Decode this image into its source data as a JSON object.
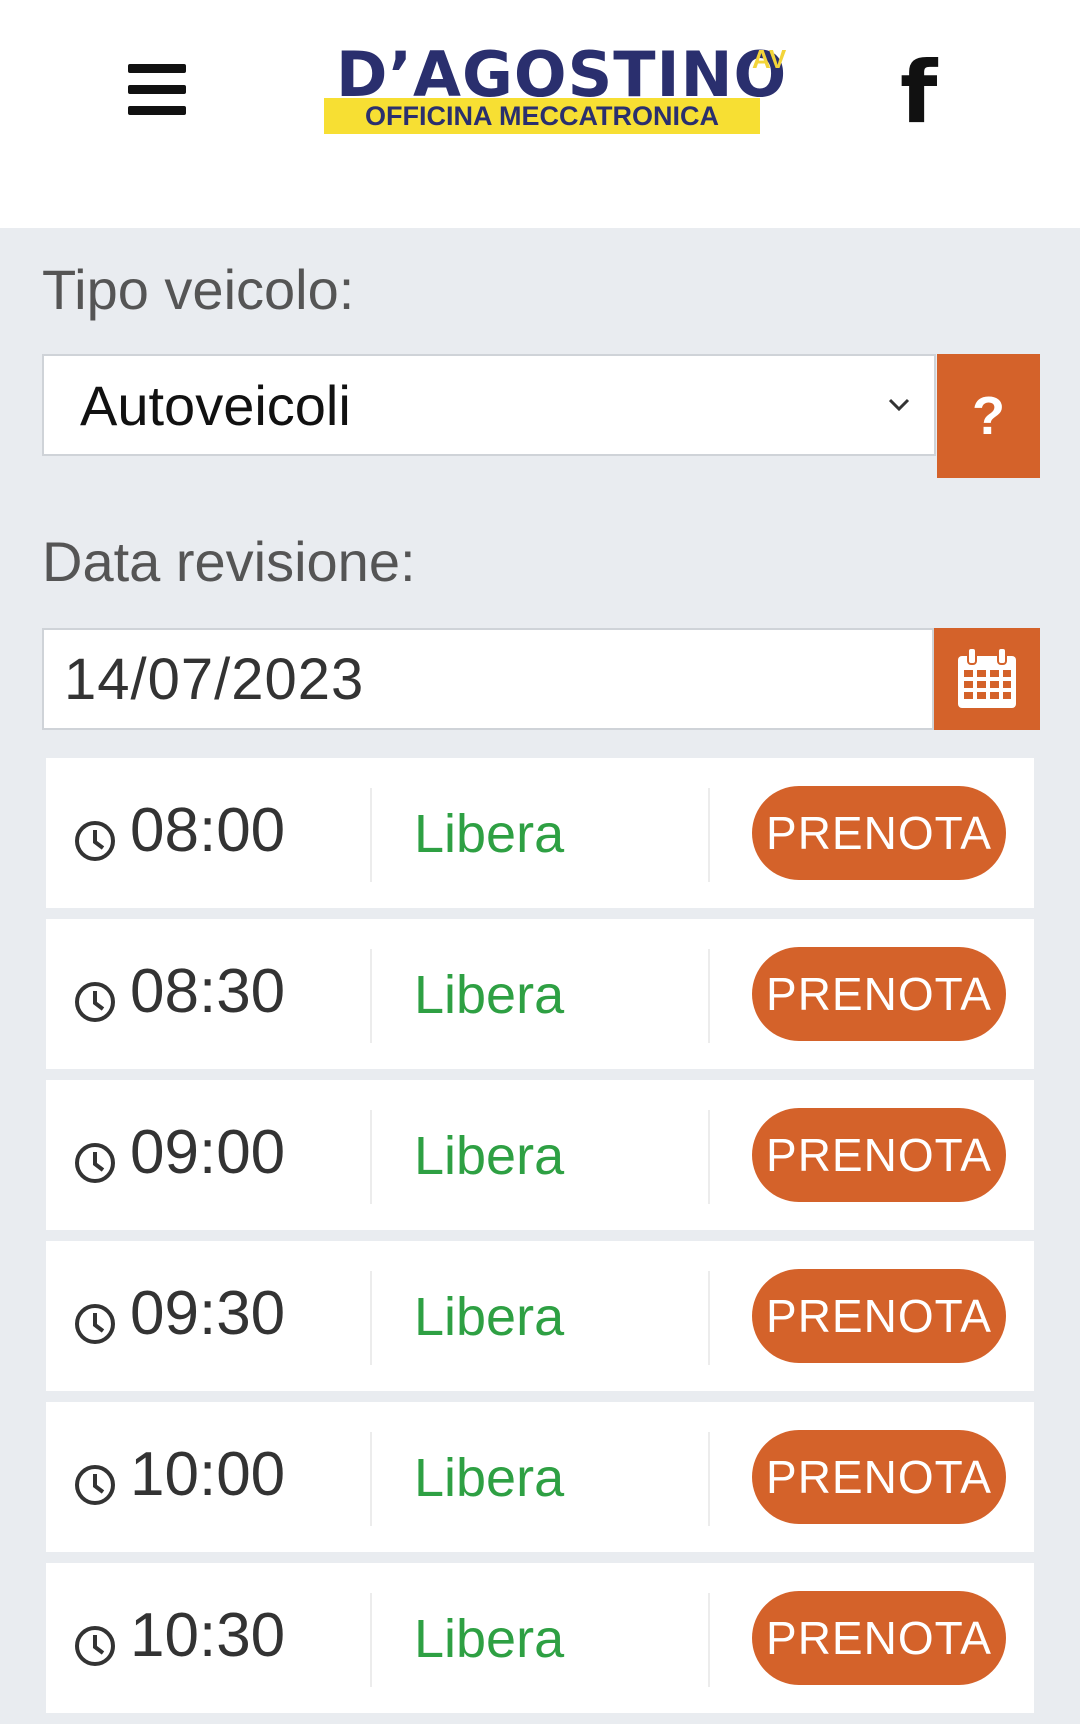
{
  "header": {
    "logo_title": "D’AGOSTINO",
    "logo_superscript": "AV",
    "logo_subtitle": "OFFICINA MECCATRONICA",
    "facebook_glyph": "f"
  },
  "form": {
    "vehicle_type_label": "Tipo veicolo:",
    "vehicle_type_value": "Autoveicoli",
    "help_label": "?",
    "date_label": "Data revisione:",
    "date_value": "14/07/2023"
  },
  "slots": [
    {
      "time": "08:00",
      "status": "Libera",
      "action": "PRENOTA"
    },
    {
      "time": "08:30",
      "status": "Libera",
      "action": "PRENOTA"
    },
    {
      "time": "09:00",
      "status": "Libera",
      "action": "PRENOTA"
    },
    {
      "time": "09:30",
      "status": "Libera",
      "action": "PRENOTA"
    },
    {
      "time": "10:00",
      "status": "Libera",
      "action": "PRENOTA"
    },
    {
      "time": "10:30",
      "status": "Libera",
      "action": "PRENOTA"
    }
  ],
  "colors": {
    "accent": "#d4622a",
    "status_free": "#2ea043",
    "brand_navy": "#2a2f6e",
    "brand_yellow": "#f7df33",
    "page_background": "#e9ecf0"
  },
  "icons": [
    "menu-icon",
    "facebook-icon",
    "chevron-down-icon",
    "calendar-icon",
    "clock-icon"
  ]
}
